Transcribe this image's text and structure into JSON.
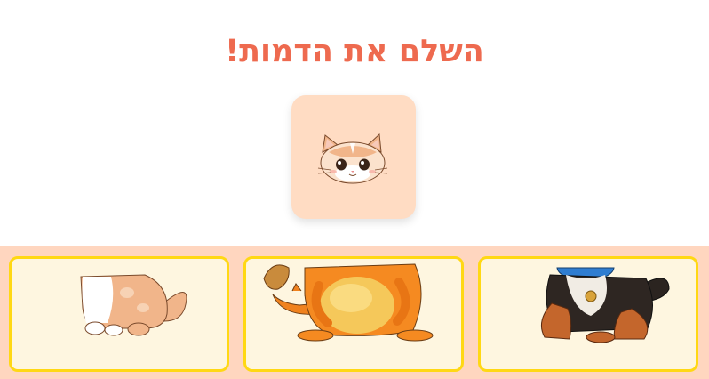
{
  "title": "השלם את הדמות!",
  "target": {
    "icon": "cat-head-icon"
  },
  "options": [
    {
      "icon": "cat-body-icon"
    },
    {
      "icon": "dragon-body-icon"
    },
    {
      "icon": "dog-body-icon"
    }
  ],
  "colors": {
    "title": "#ee6a4f",
    "card": "#ffdcc3",
    "tray": "#ffd6bf",
    "option_bg": "#fef6e0",
    "option_border": "#ffd814"
  }
}
